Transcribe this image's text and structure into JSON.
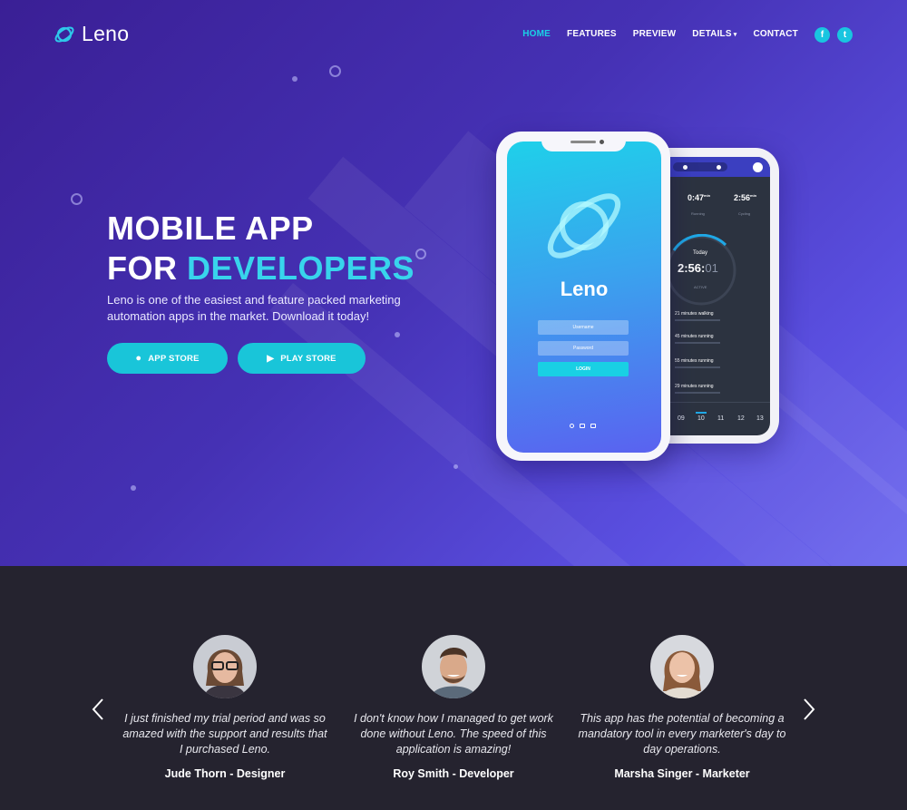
{
  "brand": {
    "name": "Leno"
  },
  "nav": {
    "items": [
      {
        "label": "HOME",
        "active": true
      },
      {
        "label": "FEATURES",
        "active": false
      },
      {
        "label": "PREVIEW",
        "active": false
      },
      {
        "label": "DETAILS",
        "active": false,
        "dropdown": true
      },
      {
        "label": "CONTACT",
        "active": false
      }
    ],
    "social": [
      {
        "icon": "facebook-icon",
        "glyph": "f"
      },
      {
        "icon": "twitter-icon",
        "glyph": "t"
      }
    ]
  },
  "hero": {
    "title_line1": "MOBILE APP",
    "title_line2_white": "FOR ",
    "title_line2_accent": "DEVELOPERS",
    "subtitle": "Leno is one of the easiest and feature packed marketing automation apps in the market. Download it today!",
    "buttons": [
      {
        "label": "APP STORE",
        "icon": "apple-icon"
      },
      {
        "label": "PLAY STORE",
        "icon": "play-icon"
      }
    ]
  },
  "phone_front": {
    "app_name": "Leno",
    "username_placeholder": "Username",
    "password_placeholder": "Password",
    "login_label": "LOGIN"
  },
  "phone_back": {
    "stat1_value": "0:47",
    "stat1_unit": "min",
    "stat1_label": "Running",
    "stat2_value": "2:56",
    "stat2_unit": "min",
    "stat2_label": "Cycling",
    "today_label": "Today",
    "timer_main": "2:56:",
    "timer_dim": "01",
    "timer_status": "ACTIVE",
    "activities": [
      "21 minutes walking",
      "45 minutes running",
      "55 minutes running",
      "29 minutes running"
    ],
    "days": [
      {
        "num": "09"
      },
      {
        "num": "10"
      },
      {
        "num": "11"
      },
      {
        "num": "12"
      },
      {
        "num": "13"
      }
    ]
  },
  "testimonials": [
    {
      "quote": "I just finished my trial period and was so amazed with the support and results that I purchased Leno.",
      "author": "Jude Thorn - Designer"
    },
    {
      "quote": "I don't know how I managed to get work done without Leno. The speed of this application is amazing!",
      "author": "Roy Smith - Developer"
    },
    {
      "quote": "This app has the potential of becoming a mandatory tool in every marketer's day to day operations.",
      "author": "Marsha Singer - Marketer"
    }
  ],
  "colors": {
    "accent": "#19c5d9",
    "hero_start": "#3a1f95",
    "hero_end": "#6a66ee",
    "dark_bg": "#25232f"
  }
}
